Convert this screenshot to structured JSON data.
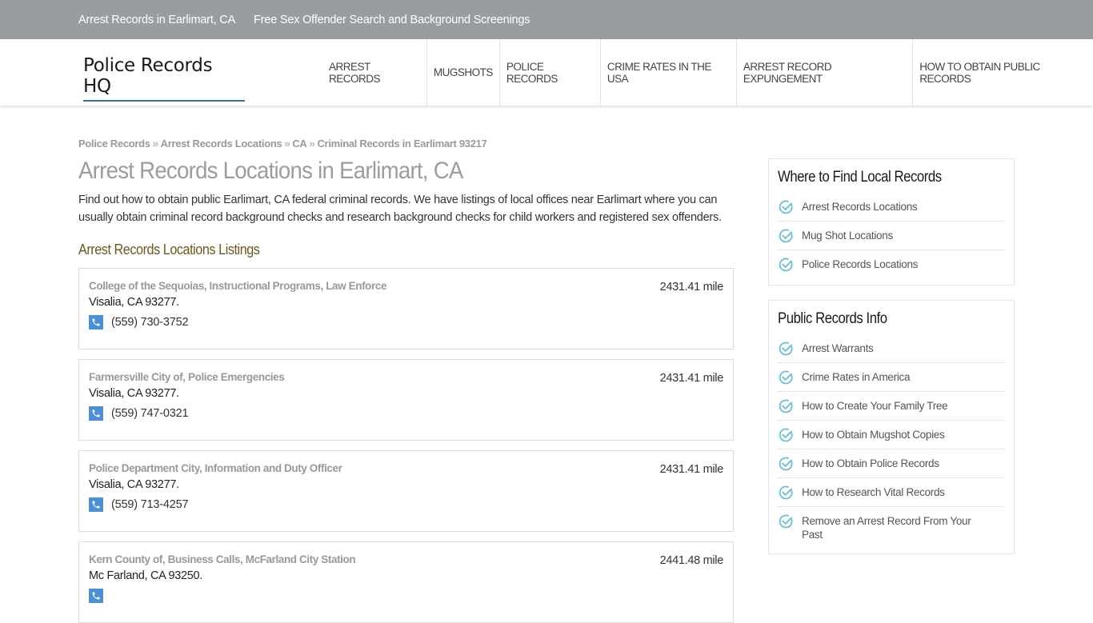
{
  "topbar": {
    "links": [
      "Arrest Records in Earlimart, CA",
      "Free Sex Offender Search and Background Screenings"
    ]
  },
  "header": {
    "logo": "Police Records HQ",
    "nav": [
      "ARREST RECORDS",
      "MUGSHOTS",
      "POLICE RECORDS",
      "CRIME RATES IN THE USA",
      "ARREST RECORD EXPUNGEMENT",
      "HOW TO OBTAIN PUBLIC RECORDS"
    ]
  },
  "breadcrumb": {
    "items": [
      "Police Records",
      "Arrest Records Locations",
      "CA",
      "Criminal Records in Earlimart 93217"
    ],
    "separator": "»"
  },
  "main": {
    "title": "Arrest Records Locations in Earlimart, CA",
    "intro": "Find out how to obtain public Earlimart, CA federal criminal records. We have listings of local offices near Earlimart where you can usually obtain criminal record background checks and research background checks for child workers and registered sex offenders.",
    "listings_heading": "Arrest Records Locations Listings",
    "listings": [
      {
        "name": "College of the Sequoias, Instructional Programs, Law Enforce",
        "address": "Visalia, CA 93277.",
        "phone": "(559) 730-3752",
        "distance": "2431.41 mile"
      },
      {
        "name": "Farmersville City of, Police Emergencies",
        "address": "Visalia, CA 93277.",
        "phone": "(559) 747-0321",
        "distance": "2431.41 mile"
      },
      {
        "name": "Police Department City, Information and Duty Officer",
        "address": "Visalia, CA 93277.",
        "phone": "(559) 713-4257",
        "distance": "2431.41 mile"
      },
      {
        "name": "Kern County of, Business Calls, McFarland City Station",
        "address": "Mc Farland, CA 93250.",
        "phone": "",
        "distance": "2441.48 mile"
      }
    ]
  },
  "sidebar": {
    "widgets": [
      {
        "title": "Where to Find Local Records",
        "items": [
          "Arrest Records Locations",
          "Mug Shot Locations",
          "Police Records Locations"
        ]
      },
      {
        "title": "Public Records Info",
        "items": [
          "Arrest Warrants",
          "Crime Rates in America",
          "How to Create Your Family Tree",
          "How to Obtain Mugshot Copies",
          "How to Obtain Police Records",
          "How to Research Vital Records",
          "Remove an Arrest Record From Your Past"
        ]
      }
    ]
  },
  "icons": {
    "phone": "phone-icon",
    "check": "check-circle-icon"
  },
  "colors": {
    "topbar_bg": "#9a9d9f",
    "logo_underline": "#3a6ea5",
    "phone_icon_bg": "#4a90d9",
    "check_icon": "#6bbfd6",
    "listings_heading": "#6b5a1e"
  }
}
